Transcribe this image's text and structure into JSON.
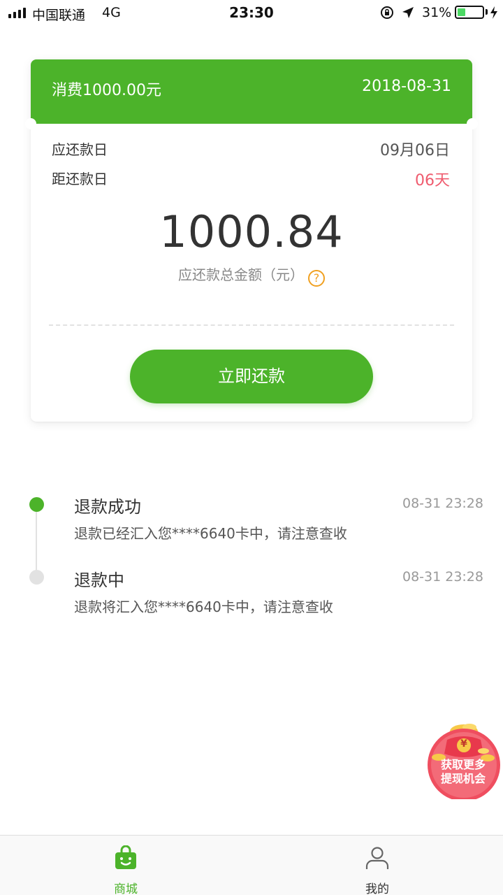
{
  "status_bar": {
    "carrier": "中国联通",
    "network": "4G",
    "time": "23:30",
    "battery_percent": "31%",
    "battery_level": 0.31,
    "icons": [
      "signal-icon",
      "orientation-lock-icon",
      "location-arrow-icon",
      "battery-icon",
      "charging-icon"
    ]
  },
  "bill": {
    "consumption": "消费1000.00元",
    "date": "2018-08-31",
    "due_date_label": "应还款日",
    "due_date_value": "09月06日",
    "days_left_label": "距还款日",
    "days_left_value": "06天",
    "total_amount": "1000.84",
    "total_caption": "应还款总金额（元）",
    "help_icon": "?",
    "pay_button": "立即还款"
  },
  "timeline": [
    {
      "title": "退款成功",
      "time": "08-31 23:28",
      "description": "退款已经汇入您****6640卡中，请注意查收",
      "state": "done"
    },
    {
      "title": "退款中",
      "time": "08-31 23:28",
      "description": "退款将汇入您****6640卡中，请注意查收",
      "state": "pending"
    }
  ],
  "promo": {
    "line1": "获取更多",
    "line2": "提现机会",
    "coin_symbol": "¥"
  },
  "tabbar": {
    "mall": "商城",
    "mine": "我的",
    "active": "mall"
  },
  "colors": {
    "brand_green": "#4cb32a",
    "alert_red": "#ef5b6e",
    "help_orange": "#f0a020",
    "promo_red": "#e94560"
  }
}
